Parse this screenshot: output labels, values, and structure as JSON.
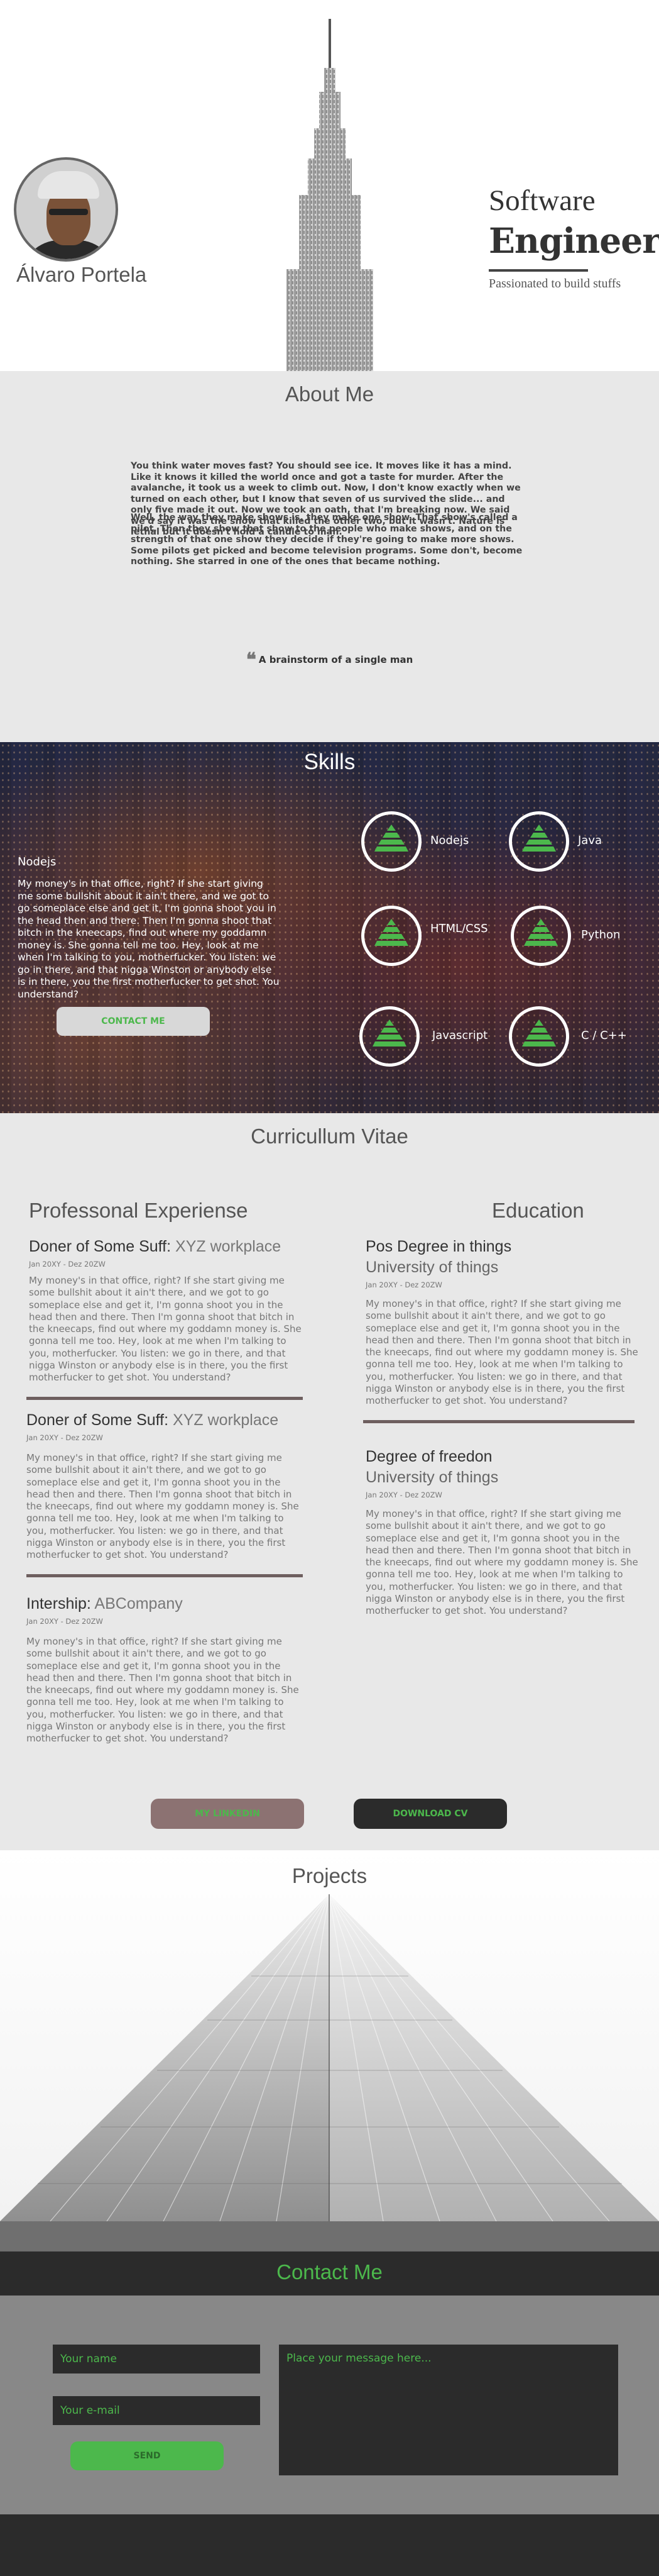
{
  "header": {
    "name": "Álvaro Portela",
    "title_line1": "Software",
    "title_line2": "Engineer",
    "tagline": "Passionated to build stuffs"
  },
  "about": {
    "heading": "About Me",
    "paragraph1": "You think water moves fast? You should see ice. It moves like it has a mind. Like it knows it killed the world once and got a taste for murder. After the avalanche, it took us a week to climb out. Now, I don't know exactly when we turned on each other, but I know that seven of us survived the slide... and only five made it out. Now we took an oath, that I'm breaking now. We said we'd say it was the snow that killed the other two, but it wasn't. Nature is lethal but it doesn't hold a candle to man.",
    "paragraph2": "Well, the way they make shows is, they make one show. That show's called a pilot. Then they show that show to the people who make shows, and on the strength of that one show they decide if they're going to make more shows. Some pilots get picked and become television programs. Some don't, become nothing. She starred in one of the ones that became nothing.",
    "quote": "A brainstorm of a single man"
  },
  "skills": {
    "heading": "Skills",
    "selected_title": "Nodejs",
    "selected_desc": "My money's in that office, right? If she start giving me some bullshit about it ain't there, and we got to go someplace else and get it, I'm gonna shoot you in the head then and there. Then I'm gonna shoot that bitch in the kneecaps, find out where my goddamn money is. She gonna tell me too. Hey, look at me when I'm talking to you, motherfucker. You listen: we go in there, and that nigga Winston or anybody else is in there, you the first motherfucker to get shot. You understand?",
    "contact_button": "CONTACT ME",
    "items": [
      {
        "label": "Nodejs"
      },
      {
        "label": "Java"
      },
      {
        "label": "HTML/CSS"
      },
      {
        "label": "Python"
      },
      {
        "label": "Javascript"
      },
      {
        "label": "C / C++"
      }
    ],
    "icon_color": "#4cb84c"
  },
  "cv": {
    "heading": "Curricullum Vitae",
    "experience_heading": "Professonal Experiense",
    "education_heading": "Education",
    "experience": [
      {
        "role": "Doner of Some Suff:",
        "org": "XYZ workplace",
        "date": "Jan 20XY - Dez 20ZW",
        "text": "My money's in that office, right? If she start giving me some bullshit about it ain't there, and we got to go someplace else and get it, I'm gonna shoot you in the head then and there. Then I'm gonna shoot that bitch in the kneecaps, find out where my goddamn money is. She gonna tell me too. Hey, look at me when I'm talking to you, motherfucker. You listen: we go in there, and that nigga Winston or anybody else is in there, you the first motherfucker to get shot. You understand?"
      },
      {
        "role": "Doner of Some Suff:",
        "org": "XYZ workplace",
        "date": "Jan 20XY - Dez 20ZW",
        "text": "My money's in that office, right? If she start giving me some bullshit about it ain't there, and we got to go someplace else and get it, I'm gonna shoot you in the head then and there. Then I'm gonna shoot that bitch in the kneecaps, find out where my goddamn money is. She gonna tell me too. Hey, look at me when I'm talking to you, motherfucker. You listen: we go in there, and that nigga Winston or anybody else is in there, you the first motherfucker to get shot. You understand?"
      },
      {
        "role": "Intership:",
        "org": "ABCompany",
        "date": "Jan 20XY - Dez 20ZW",
        "text": "My money's in that office, right? If she start giving me some bullshit about it ain't there, and we got to go someplace else and get it, I'm gonna shoot you in the head then and there. Then I'm gonna shoot that bitch in the kneecaps, find out where my goddamn money is. She gonna tell me too. Hey, look at me when I'm talking to you, motherfucker. You listen: we go in there, and that nigga Winston or anybody else is in there, you the first motherfucker to get shot. You understand?"
      }
    ],
    "education": [
      {
        "degree": "Pos Degree in things",
        "school": "University of things",
        "date": "Jan 20XY - Dez 20ZW",
        "text": "My money's in that office, right? If she start giving me some bullshit about it ain't there, and we got to go someplace else and get it, I'm gonna shoot you in the head then and there. Then I'm gonna shoot that bitch in the kneecaps, find out where my goddamn money is. She gonna tell me too. Hey, look at me when I'm talking to you, motherfucker. You listen: we go in there, and that nigga Winston or anybody else is in there, you the first motherfucker to get shot. You understand?"
      },
      {
        "degree": "Degree of freedon",
        "school": "University of things",
        "date": "Jan 20XY - Dez 20ZW",
        "text": "My money's in that office, right? If she start giving me some bullshit about it ain't there, and we got to go someplace else and get it, I'm gonna shoot you in the head then and there. Then I'm gonna shoot that bitch in the kneecaps, find out where my goddamn money is. She gonna tell me too. Hey, look at me when I'm talking to you, motherfucker. You listen: we go in there, and that nigga Winston or anybody else is in there, you the first motherfucker to get shot. You understand?"
      }
    ],
    "linkedin_button": "MY LINKEDIN",
    "download_button": "DOWNLOAD CV"
  },
  "projects": {
    "heading": "Projects"
  },
  "contact": {
    "heading": "Contact Me",
    "name_placeholder": "Your name",
    "email_placeholder": "Your e-mail",
    "message_placeholder": "Place your message here...",
    "send_button": "SEND",
    "accent_color": "#4cb84c"
  }
}
